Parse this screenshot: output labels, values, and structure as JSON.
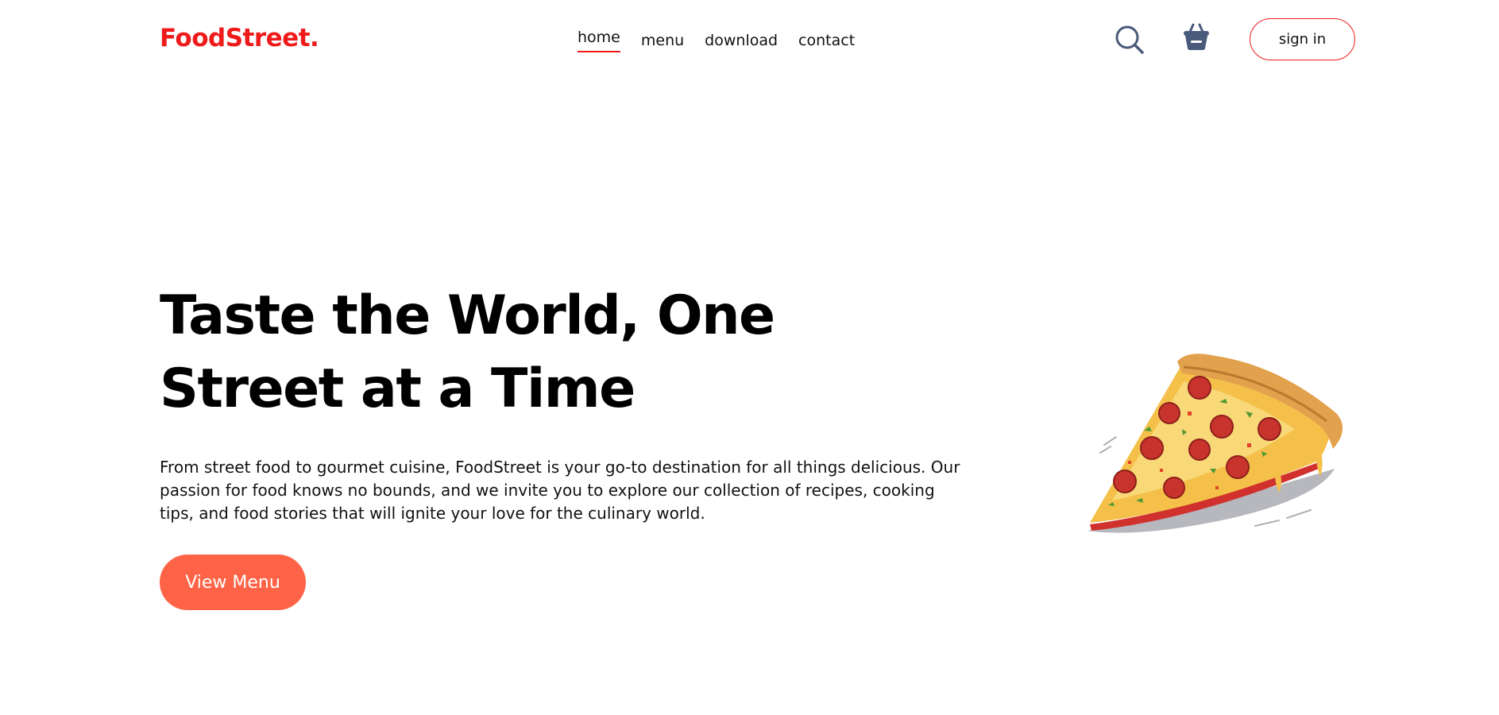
{
  "brand": {
    "logo_text": "FoodStreet.",
    "accent_color": "#ef1b1b",
    "button_color": "#ff6347"
  },
  "nav": {
    "items": [
      {
        "label": "home",
        "active": true
      },
      {
        "label": "menu",
        "active": false
      },
      {
        "label": "download",
        "active": false
      },
      {
        "label": "contact",
        "active": false
      }
    ]
  },
  "header_actions": {
    "search_icon": "search-icon",
    "basket_icon": "basket-icon",
    "signin_label": "sign in"
  },
  "hero": {
    "title": "Taste the World, One Street at a Time",
    "description": "From street food to gourmet cuisine, FoodStreet is your go-to destination for all things delicious. Our passion for food knows no bounds, and we invite you to explore our collection of recipes, cooking tips, and food stories that will ignite your love for the culinary world.",
    "cta_label": "View Menu",
    "image": "pizza-slice-illustration"
  }
}
